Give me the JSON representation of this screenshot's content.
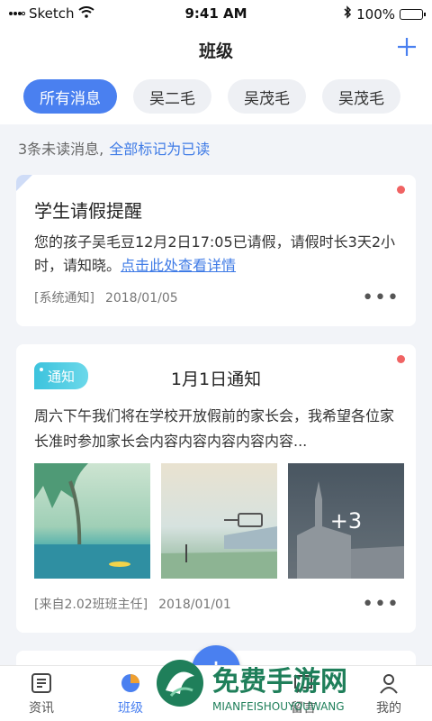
{
  "status": {
    "carrier": "Sketch",
    "time": "9:41 AM",
    "battery": "100%"
  },
  "nav": {
    "title": "班级"
  },
  "chips": [
    {
      "label": "所有消息",
      "active": true
    },
    {
      "label": "吴二毛",
      "active": false
    },
    {
      "label": "吴茂毛",
      "active": false
    },
    {
      "label": "吴茂毛",
      "active": false
    }
  ],
  "unread": {
    "text": "3条未读消息,",
    "link": "全部标记为已读"
  },
  "messages": [
    {
      "title": "学生请假提醒",
      "body": "您的孩子吴毛豆12月2日17:05已请假，请假时长3天2小时，请知晓。",
      "link": "点击此处查看详情",
      "source": "[系统通知]",
      "date": "2018/01/05"
    },
    {
      "tag": "通知",
      "title": "1月1日通知",
      "body": "周六下午我们将在学校开放假前的家长会，我希望各位家长准时参加家长会内容内容内容内容内容...",
      "more_photos": "+3",
      "source": "[来自2.02班班主任]",
      "date": "2018/01/01"
    }
  ],
  "tabs": [
    {
      "label": "资讯",
      "icon": "news-icon"
    },
    {
      "label": "班级",
      "icon": "class-icon",
      "active": true
    },
    {
      "label": "留言",
      "icon": "message-icon"
    },
    {
      "label": "我的",
      "icon": "profile-icon"
    }
  ],
  "fab": {
    "label": "+"
  },
  "watermark": {
    "title": "免费手游网",
    "subtitle": "MIANFEISHOUYOUWANG"
  },
  "colors": {
    "accent": "#4a80f0",
    "link": "#3f7be6",
    "unread_dot": "#f06363",
    "tag": "#3cc3dd"
  }
}
